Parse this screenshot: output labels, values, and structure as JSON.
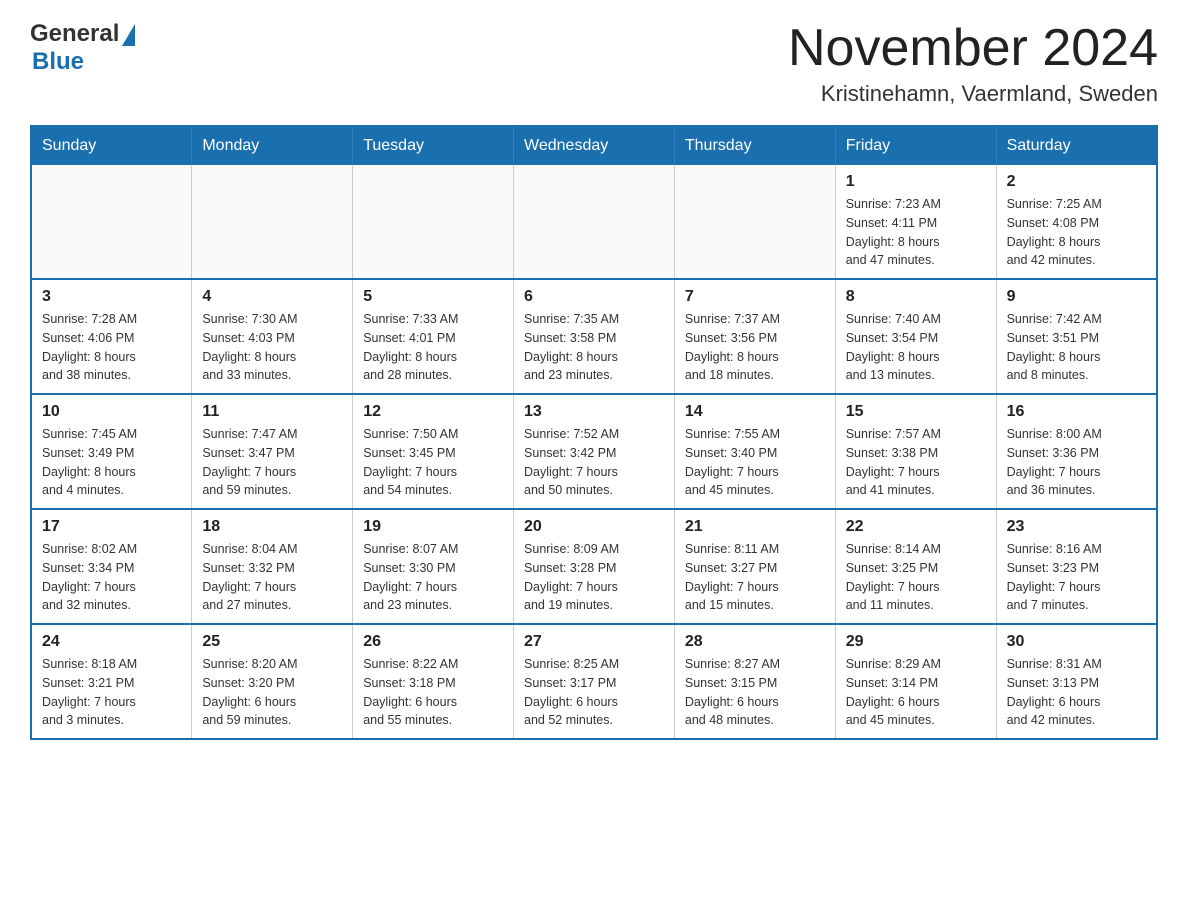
{
  "header": {
    "logo_general": "General",
    "logo_blue": "Blue",
    "month_title": "November 2024",
    "location": "Kristinehamn, Vaermland, Sweden"
  },
  "weekdays": [
    "Sunday",
    "Monday",
    "Tuesday",
    "Wednesday",
    "Thursday",
    "Friday",
    "Saturday"
  ],
  "weeks": [
    [
      {
        "day": "",
        "info": ""
      },
      {
        "day": "",
        "info": ""
      },
      {
        "day": "",
        "info": ""
      },
      {
        "day": "",
        "info": ""
      },
      {
        "day": "",
        "info": ""
      },
      {
        "day": "1",
        "info": "Sunrise: 7:23 AM\nSunset: 4:11 PM\nDaylight: 8 hours\nand 47 minutes."
      },
      {
        "day": "2",
        "info": "Sunrise: 7:25 AM\nSunset: 4:08 PM\nDaylight: 8 hours\nand 42 minutes."
      }
    ],
    [
      {
        "day": "3",
        "info": "Sunrise: 7:28 AM\nSunset: 4:06 PM\nDaylight: 8 hours\nand 38 minutes."
      },
      {
        "day": "4",
        "info": "Sunrise: 7:30 AM\nSunset: 4:03 PM\nDaylight: 8 hours\nand 33 minutes."
      },
      {
        "day": "5",
        "info": "Sunrise: 7:33 AM\nSunset: 4:01 PM\nDaylight: 8 hours\nand 28 minutes."
      },
      {
        "day": "6",
        "info": "Sunrise: 7:35 AM\nSunset: 3:58 PM\nDaylight: 8 hours\nand 23 minutes."
      },
      {
        "day": "7",
        "info": "Sunrise: 7:37 AM\nSunset: 3:56 PM\nDaylight: 8 hours\nand 18 minutes."
      },
      {
        "day": "8",
        "info": "Sunrise: 7:40 AM\nSunset: 3:54 PM\nDaylight: 8 hours\nand 13 minutes."
      },
      {
        "day": "9",
        "info": "Sunrise: 7:42 AM\nSunset: 3:51 PM\nDaylight: 8 hours\nand 8 minutes."
      }
    ],
    [
      {
        "day": "10",
        "info": "Sunrise: 7:45 AM\nSunset: 3:49 PM\nDaylight: 8 hours\nand 4 minutes."
      },
      {
        "day": "11",
        "info": "Sunrise: 7:47 AM\nSunset: 3:47 PM\nDaylight: 7 hours\nand 59 minutes."
      },
      {
        "day": "12",
        "info": "Sunrise: 7:50 AM\nSunset: 3:45 PM\nDaylight: 7 hours\nand 54 minutes."
      },
      {
        "day": "13",
        "info": "Sunrise: 7:52 AM\nSunset: 3:42 PM\nDaylight: 7 hours\nand 50 minutes."
      },
      {
        "day": "14",
        "info": "Sunrise: 7:55 AM\nSunset: 3:40 PM\nDaylight: 7 hours\nand 45 minutes."
      },
      {
        "day": "15",
        "info": "Sunrise: 7:57 AM\nSunset: 3:38 PM\nDaylight: 7 hours\nand 41 minutes."
      },
      {
        "day": "16",
        "info": "Sunrise: 8:00 AM\nSunset: 3:36 PM\nDaylight: 7 hours\nand 36 minutes."
      }
    ],
    [
      {
        "day": "17",
        "info": "Sunrise: 8:02 AM\nSunset: 3:34 PM\nDaylight: 7 hours\nand 32 minutes."
      },
      {
        "day": "18",
        "info": "Sunrise: 8:04 AM\nSunset: 3:32 PM\nDaylight: 7 hours\nand 27 minutes."
      },
      {
        "day": "19",
        "info": "Sunrise: 8:07 AM\nSunset: 3:30 PM\nDaylight: 7 hours\nand 23 minutes."
      },
      {
        "day": "20",
        "info": "Sunrise: 8:09 AM\nSunset: 3:28 PM\nDaylight: 7 hours\nand 19 minutes."
      },
      {
        "day": "21",
        "info": "Sunrise: 8:11 AM\nSunset: 3:27 PM\nDaylight: 7 hours\nand 15 minutes."
      },
      {
        "day": "22",
        "info": "Sunrise: 8:14 AM\nSunset: 3:25 PM\nDaylight: 7 hours\nand 11 minutes."
      },
      {
        "day": "23",
        "info": "Sunrise: 8:16 AM\nSunset: 3:23 PM\nDaylight: 7 hours\nand 7 minutes."
      }
    ],
    [
      {
        "day": "24",
        "info": "Sunrise: 8:18 AM\nSunset: 3:21 PM\nDaylight: 7 hours\nand 3 minutes."
      },
      {
        "day": "25",
        "info": "Sunrise: 8:20 AM\nSunset: 3:20 PM\nDaylight: 6 hours\nand 59 minutes."
      },
      {
        "day": "26",
        "info": "Sunrise: 8:22 AM\nSunset: 3:18 PM\nDaylight: 6 hours\nand 55 minutes."
      },
      {
        "day": "27",
        "info": "Sunrise: 8:25 AM\nSunset: 3:17 PM\nDaylight: 6 hours\nand 52 minutes."
      },
      {
        "day": "28",
        "info": "Sunrise: 8:27 AM\nSunset: 3:15 PM\nDaylight: 6 hours\nand 48 minutes."
      },
      {
        "day": "29",
        "info": "Sunrise: 8:29 AM\nSunset: 3:14 PM\nDaylight: 6 hours\nand 45 minutes."
      },
      {
        "day": "30",
        "info": "Sunrise: 8:31 AM\nSunset: 3:13 PM\nDaylight: 6 hours\nand 42 minutes."
      }
    ]
  ]
}
